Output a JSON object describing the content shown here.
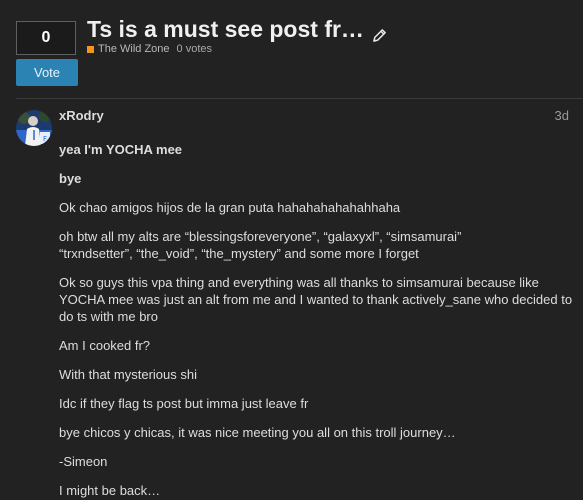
{
  "topic": {
    "title": "Ts is a must see post fr…",
    "category": "The Wild Zone",
    "category_color": "#f7941d",
    "votes_text": "0 votes",
    "edit_icon": "pencil-icon"
  },
  "vote_widget": {
    "count": "0",
    "button_label": "Vote",
    "button_color": "#2b83b3"
  },
  "post": {
    "username": "xRodry",
    "date": "3d",
    "avatar": "user-avatar",
    "paragraphs": [
      {
        "text": "yea I'm YOCHA mee",
        "bold": true
      },
      {
        "text": "bye",
        "bold": true
      },
      {
        "text": "Ok chao amigos hijos de la gran puta hahahahahahahhaha"
      },
      {
        "text": "oh btw all my alts are “blessingsforeveryone”, “galaxyxl”, “simsamurai”"
      },
      {
        "text": "“trxndsetter”, “the_void”, “the_mystery” and some more I forget"
      },
      {
        "text": "Ok so guys this vpa thing and everything was all thanks to simsamurai because like YOCHA mee was just an alt from me and I wanted to thank actively_sane who decided to do ts with me bro"
      },
      {
        "text": "Am I cooked fr?"
      },
      {
        "text": "With that mysterious shi"
      },
      {
        "text": "Idc if they flag ts post but imma just leave fr"
      },
      {
        "text": "bye chicos y chicas, it was nice meeting you all on this troll journey…"
      },
      {
        "text": "-Simeon"
      },
      {
        "text": "I might be back…"
      }
    ]
  }
}
